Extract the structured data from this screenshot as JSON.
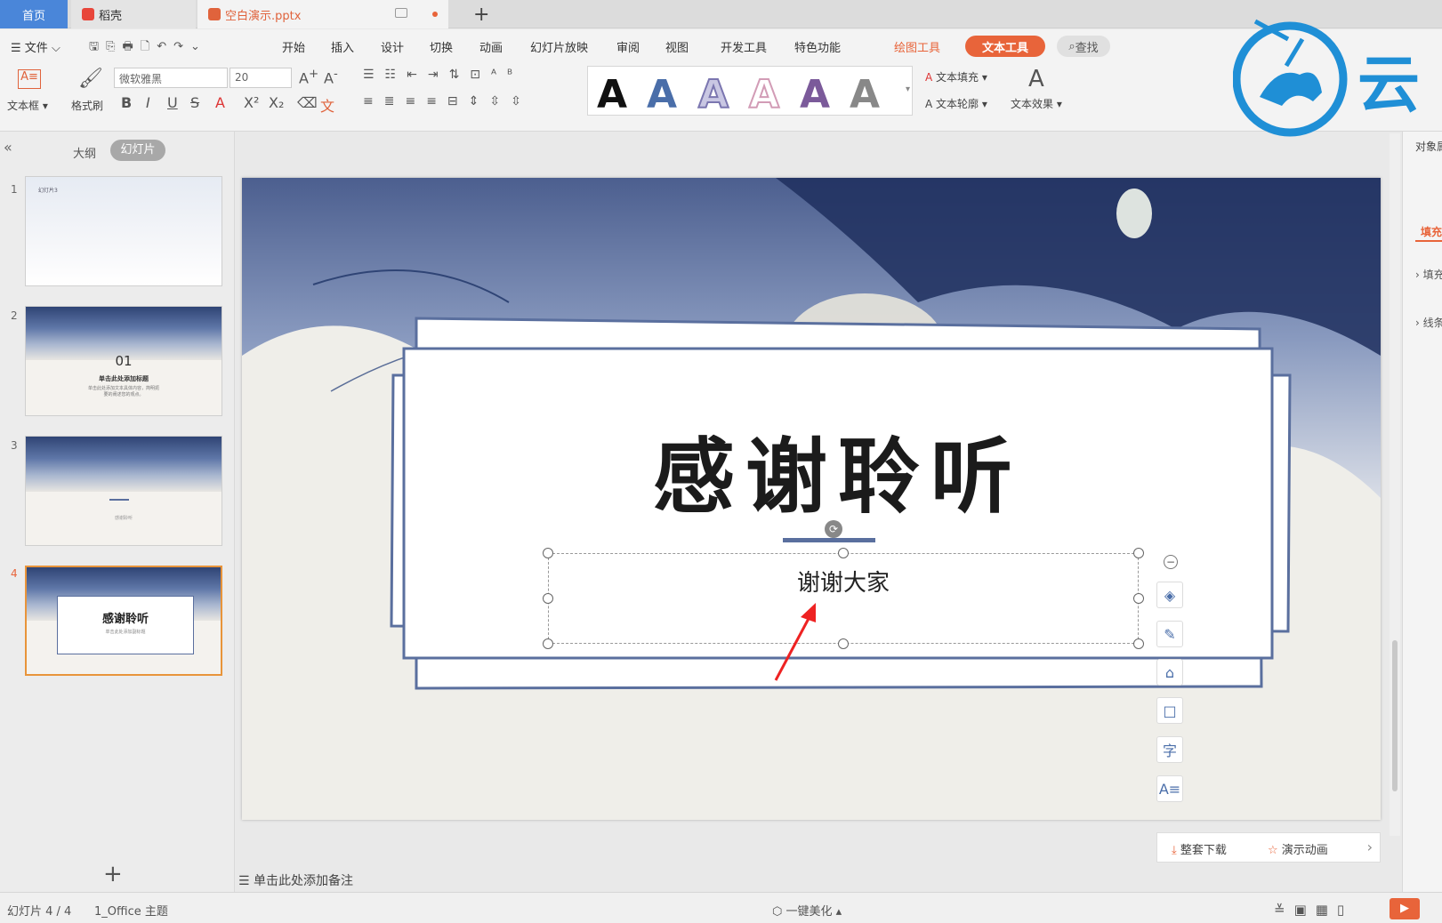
{
  "tabs": {
    "home": "首页",
    "daoke": "稻壳",
    "file": "空白演示.pptx",
    "add": "+"
  },
  "menu": {
    "file": "文件",
    "items": [
      "开始",
      "插入",
      "设计",
      "切换",
      "动画",
      "幻灯片放映",
      "审阅",
      "视图",
      "开发工具",
      "特色功能"
    ],
    "drawing_tools": "绘图工具",
    "text_tools": "文本工具",
    "search": "查找"
  },
  "ribbon": {
    "textbox": "文本框",
    "format_painter": "格式刷",
    "font_name": "微软雅黑",
    "font_size": "20",
    "text_fill": "文本填充",
    "text_outline": "文本轮廓",
    "text_effect": "文本效果",
    "wordart_letter": "A"
  },
  "panel": {
    "outline_tab": "大纲",
    "slides_tab": "幻灯片",
    "add": "+"
  },
  "thumbs": {
    "t1_title": "幻灯片3",
    "t2_num": "01",
    "t2_title": "单击此处添加标题",
    "t2_sub": "单击此处添加文本具体内容，简明扼",
    "t2_sub2": "要的阐述您的观点。",
    "t3_text": "感谢聆听",
    "t4_title": "感谢聆听",
    "t4_sub": "单击此处添加副标题"
  },
  "slide_numbers": [
    "1",
    "2",
    "3",
    "4"
  ],
  "slide": {
    "title": "感谢聆听",
    "subtitle": "谢谢大家"
  },
  "floating": {
    "download": "整套下载",
    "animation": "演示动画"
  },
  "notes": {
    "placeholder": "单击此处添加备注"
  },
  "status": {
    "slide_count": "幻灯片 4 / 4",
    "theme": "1_Office 主题",
    "beautify": "一键美化"
  },
  "right_panel": {
    "title": "对象属性",
    "fill": "填充",
    "fill_item": "填充",
    "line_item": "线条"
  },
  "logo_text": "云",
  "colors": {
    "accent_orange": "#e8643a",
    "tab_blue": "#4a86d9",
    "slide_border": "#5a6f9e"
  }
}
